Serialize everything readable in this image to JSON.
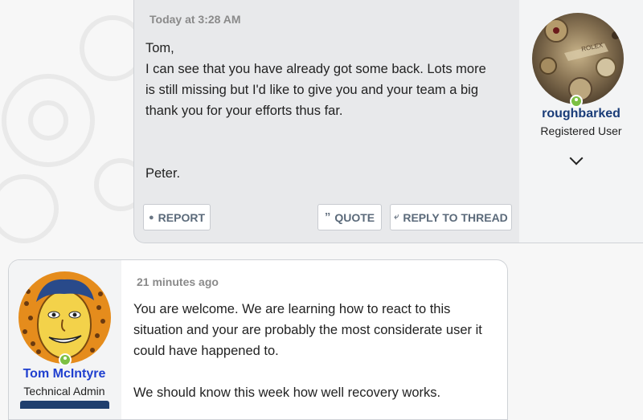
{
  "post1": {
    "timestamp": "Today at 3:28 AM",
    "message": [
      "Tom,",
      "I can see that you have already got some back. Lots more is still missing but I'd like to give you and your team a big thank you for your efforts thus far.",
      "",
      "Peter."
    ],
    "buttons": {
      "report": "REPORT",
      "quote": "QUOTE",
      "reply": "REPLY TO THREAD"
    },
    "user": {
      "name": "roughbarked",
      "role": "Registered User",
      "name_color": "#1a3c78",
      "online": true
    }
  },
  "post2": {
    "timestamp": "21 minutes ago",
    "message": [
      "You are welcome. We are learning how to react to this situation and your are probably the most considerate user it could have happened to.",
      "We should know this week how well recovery works."
    ],
    "user": {
      "name": "Tom McIntyre",
      "role": "Technical Admin",
      "name_color": "#1f3fcf",
      "online": true
    }
  },
  "colors": {
    "online": "#7cc043",
    "staff_badge": "#1f3f6e"
  }
}
